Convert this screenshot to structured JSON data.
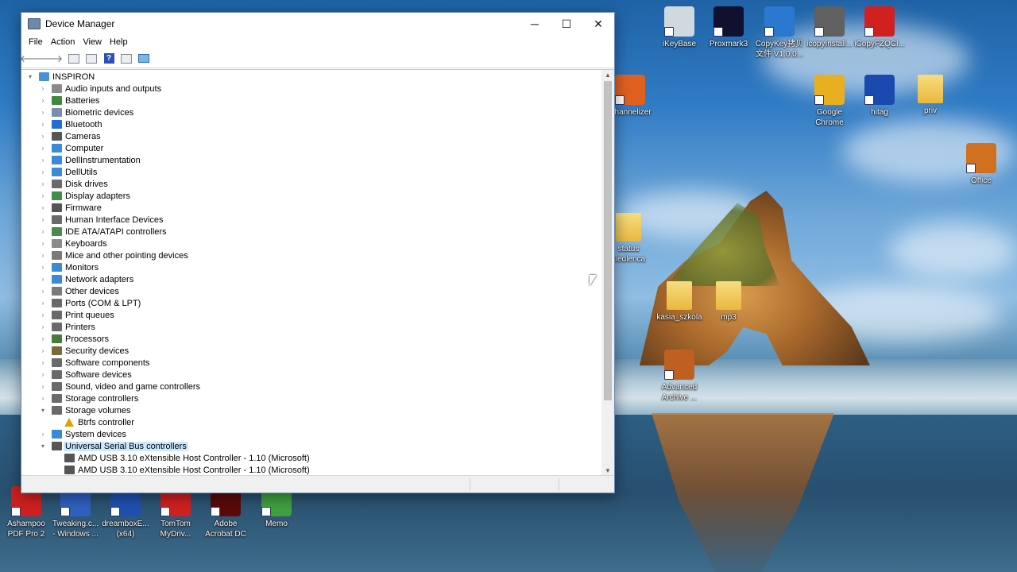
{
  "window": {
    "title": "Device Manager",
    "menu": [
      "File",
      "Action",
      "View",
      "Help"
    ],
    "controls": {
      "minimize": "─",
      "maximize": "☐",
      "close": "✕"
    }
  },
  "toolbar": [
    "back-icon",
    "forward-icon",
    "properties-icon",
    "update-driver-icon",
    "help-icon",
    "show-hidden-icon",
    "monitor-icon"
  ],
  "tree": {
    "root": "INSPIRON",
    "categories": [
      {
        "label": "Audio inputs and outputs",
        "icon": "speaker-icon",
        "color": "#8a8a8a"
      },
      {
        "label": "Batteries",
        "icon": "battery-icon",
        "color": "#3d8a3d"
      },
      {
        "label": "Biometric devices",
        "icon": "biometric-icon",
        "color": "#7a8db0"
      },
      {
        "label": "Bluetooth",
        "icon": "bluetooth-icon",
        "color": "#1f6fd1"
      },
      {
        "label": "Cameras",
        "icon": "camera-icon",
        "color": "#555555"
      },
      {
        "label": "Computer",
        "icon": "computer-icon",
        "color": "#3a8ad8"
      },
      {
        "label": "DellInstrumentation",
        "icon": "monitor-icon",
        "color": "#3a8ad8"
      },
      {
        "label": "DellUtils",
        "icon": "monitor-icon",
        "color": "#3a8ad8"
      },
      {
        "label": "Disk drives",
        "icon": "disk-icon",
        "color": "#6a6a6a"
      },
      {
        "label": "Display adapters",
        "icon": "display-adapter-icon",
        "color": "#3f8f4a"
      },
      {
        "label": "Firmware",
        "icon": "firmware-icon",
        "color": "#555555"
      },
      {
        "label": "Human Interface Devices",
        "icon": "hid-icon",
        "color": "#6a6a6a"
      },
      {
        "label": "IDE ATA/ATAPI controllers",
        "icon": "ide-icon",
        "color": "#4a8a4a"
      },
      {
        "label": "Keyboards",
        "icon": "keyboard-icon",
        "color": "#8a8a8a"
      },
      {
        "label": "Mice and other pointing devices",
        "icon": "mouse-icon",
        "color": "#7a7a7a"
      },
      {
        "label": "Monitors",
        "icon": "monitor-icon",
        "color": "#3a8ad8"
      },
      {
        "label": "Network adapters",
        "icon": "network-icon",
        "color": "#3a8ad8"
      },
      {
        "label": "Other devices",
        "icon": "other-device-icon",
        "color": "#7a7a7a"
      },
      {
        "label": "Ports (COM & LPT)",
        "icon": "port-icon",
        "color": "#6a6a6a"
      },
      {
        "label": "Print queues",
        "icon": "printer-icon",
        "color": "#6a6a6a"
      },
      {
        "label": "Printers",
        "icon": "printer-icon",
        "color": "#6a6a6a"
      },
      {
        "label": "Processors",
        "icon": "processor-icon",
        "color": "#4a7a3a"
      },
      {
        "label": "Security devices",
        "icon": "security-icon",
        "color": "#7a6a3a"
      },
      {
        "label": "Software components",
        "icon": "software-icon",
        "color": "#6a6a6a"
      },
      {
        "label": "Software devices",
        "icon": "software-icon",
        "color": "#6a6a6a"
      },
      {
        "label": "Sound, video and game controllers",
        "icon": "speaker-icon",
        "color": "#6a6a6a"
      },
      {
        "label": "Storage controllers",
        "icon": "storage-icon",
        "color": "#6a6a6a"
      },
      {
        "label": "Storage volumes",
        "icon": "disk-icon",
        "color": "#6a6a6a",
        "expanded": true,
        "children": [
          {
            "label": "Btrfs controller",
            "icon": "warning-icon",
            "color": "#e0a000"
          }
        ]
      },
      {
        "label": "System devices",
        "icon": "system-icon",
        "color": "#3a8ad8"
      },
      {
        "label": "Universal Serial Bus controllers",
        "icon": "usb-icon",
        "color": "#555555",
        "expanded": true,
        "selected": true,
        "children": [
          {
            "label": "AMD USB 3.10 eXtensible Host Controller - 1.10 (Microsoft)",
            "icon": "usb-icon",
            "color": "#555555"
          },
          {
            "label": "AMD USB 3.10 eXtensible Host Controller - 1.10 (Microsoft)",
            "icon": "usb-icon",
            "color": "#555555"
          }
        ]
      }
    ]
  },
  "desktop_icons": [
    {
      "label": "iKeyBase",
      "icon": "ikeybase-icon",
      "color": "#d0d8e0"
    },
    {
      "label": "Proxmark3",
      "icon": "proxmark-icon",
      "color": "#101030"
    },
    {
      "label": "CopyKey拷贝\n文件 V1.0.0...",
      "icon": "copykey-icon",
      "color": "#2a78d0"
    },
    {
      "label": "icopyInstall...",
      "icon": "icopy-install-icon",
      "color": "#606060"
    },
    {
      "label": "iCopyFZQCl...",
      "icon": "icopy-cd-icon",
      "color": "#d02020"
    },
    {
      "label": "Channelizer",
      "icon": "channelizer-icon",
      "color": "#e06020"
    },
    {
      "label": "Google\nChrome",
      "icon": "chrome-icon",
      "color": "#e8b020"
    },
    {
      "label": "hitag",
      "icon": "hitag-icon",
      "color": "#1a4ab0"
    },
    {
      "label": "priv",
      "icon": "folder-icon",
      "color": "#f0d060"
    },
    {
      "label": "Office",
      "icon": "office-icon",
      "color": "#d07020"
    },
    {
      "label": "status\nsiedlenca",
      "icon": "document-folder-icon",
      "color": "#f0d080"
    },
    {
      "label": "kasia_szkola",
      "icon": "folder-icon",
      "color": "#f0d080"
    },
    {
      "label": "mp3",
      "icon": "folder-icon",
      "color": "#f0d080"
    },
    {
      "label": "Advanced\nArchive ...",
      "icon": "archive-icon",
      "color": "#c06020"
    },
    {
      "label": "Ashampoo\nPDF Pro 2",
      "icon": "ashampoo-icon",
      "color": "#d02020"
    },
    {
      "label": "Tweaking.c...\n- Windows ...",
      "icon": "tweaking-icon",
      "color": "#3060c0"
    },
    {
      "label": "dreamboxE...\n(x64)",
      "icon": "dreambox-icon",
      "color": "#2050b0"
    },
    {
      "label": "TomTom\nMyDriv...",
      "icon": "tomtom-icon",
      "color": "#d02020"
    },
    {
      "label": "Adobe\nAcrobat DC",
      "icon": "acrobat-icon",
      "color": "#5a0a0a"
    },
    {
      "label": "Memo",
      "icon": "memo-icon",
      "color": "#40a040"
    }
  ]
}
